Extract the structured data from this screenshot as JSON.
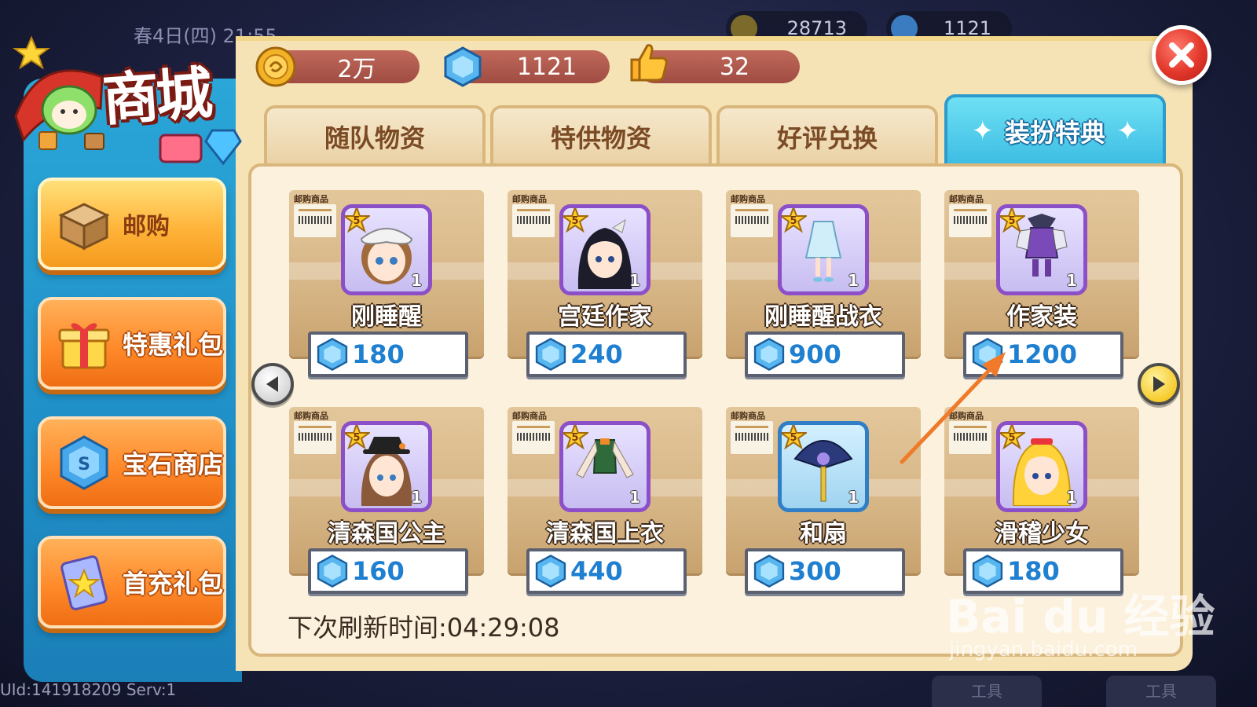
{
  "header": {
    "background_date": "春4日(四) 21:55",
    "background_coins": "28713",
    "background_gems": "1121"
  },
  "logo": {
    "title": "商城"
  },
  "currencies": [
    {
      "icon": "coin-icon",
      "value": "2万"
    },
    {
      "icon": "gem-icon",
      "value": "1121"
    },
    {
      "icon": "thumbs-up-icon",
      "value": "32"
    }
  ],
  "sidebar": {
    "items": [
      {
        "label": "邮购",
        "icon": "box-icon",
        "style": "yellow",
        "active": true
      },
      {
        "label": "特惠礼包",
        "icon": "gift-icon",
        "style": "orange"
      },
      {
        "label": "宝石商店",
        "icon": "gem-icon",
        "style": "orange"
      },
      {
        "label": "首充礼包",
        "icon": "card-icon",
        "style": "orange"
      }
    ]
  },
  "tabs": [
    {
      "label": "随队物资",
      "active": false
    },
    {
      "label": "特供物资",
      "active": false
    },
    {
      "label": "好评兑换",
      "active": false
    },
    {
      "label": "装扮特典",
      "active": true
    }
  ],
  "shop": {
    "tag": "邮购商品",
    "items": [
      {
        "name": "刚睡醒",
        "price": "180",
        "rarity": "5",
        "qty": "1",
        "frame": "purple"
      },
      {
        "name": "宫廷作家",
        "price": "240",
        "rarity": "5",
        "qty": "1",
        "frame": "purple"
      },
      {
        "name": "刚睡醒战衣",
        "price": "900",
        "rarity": "5",
        "qty": "1",
        "frame": "purple"
      },
      {
        "name": "作家装",
        "price": "1200",
        "rarity": "5",
        "qty": "1",
        "frame": "purple"
      },
      {
        "name": "清森国公主",
        "price": "160",
        "rarity": "5",
        "qty": "1",
        "frame": "purple"
      },
      {
        "name": "清森国上衣",
        "price": "440",
        "rarity": "5",
        "qty": "1",
        "frame": "purple"
      },
      {
        "name": "和扇",
        "price": "300",
        "rarity": "5",
        "qty": "1",
        "frame": "blue"
      },
      {
        "name": "滑稽少女",
        "price": "180",
        "rarity": "5",
        "qty": "1",
        "frame": "purple"
      }
    ],
    "refresh_text": "下次刷新时间:04:29:08"
  },
  "footer": {
    "uid": "UId:141918209 Serv:1",
    "bottom_btn": "工具"
  },
  "watermark": {
    "brand": "Bai du 经验",
    "url": "jingyan.baidu.com"
  },
  "colors": {
    "accent_blue": "#3cbde3",
    "panel": "#f6e3b5",
    "price_text": "#1f7fd0",
    "close_red": "#e2382b"
  }
}
